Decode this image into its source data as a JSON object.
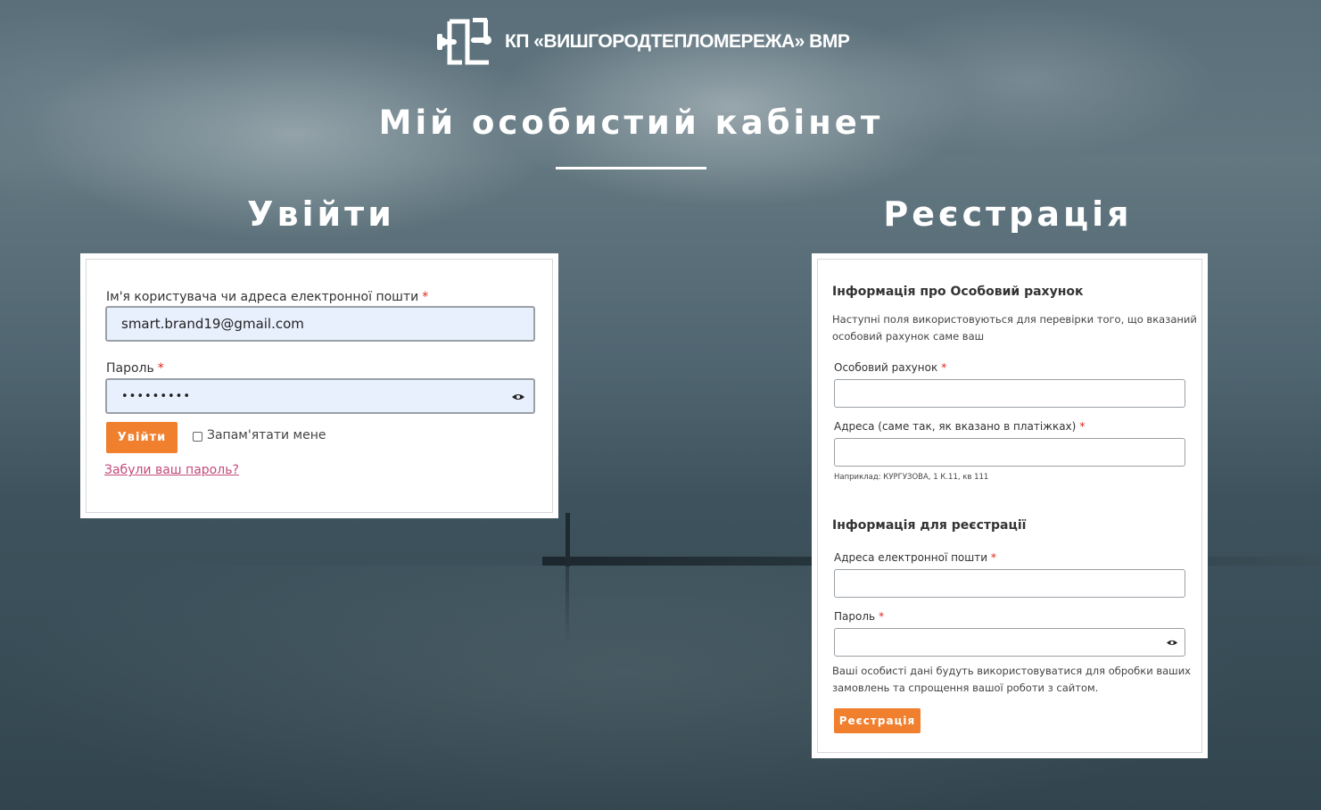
{
  "brand": {
    "name": "КП «ВИШГОРОДТЕПЛОМЕРЕЖА» ВМР",
    "accent_color": "#f07f2e",
    "logo_icon": "pipe-logo-icon"
  },
  "page": {
    "title": "Мій особистий кабінет"
  },
  "login": {
    "heading": "Увійти",
    "username_label": "Ім'я користувача чи адреса електронної пошти",
    "username_value": "smart.brand19@gmail.com",
    "password_label": "Пароль",
    "password_value": "•••••••••",
    "submit_label": "Увійти",
    "remember_label": "Запам'ятати мене",
    "remember_checked": false,
    "forgot_link": "Забули ваш пароль?",
    "required_mark": "*"
  },
  "register": {
    "heading": "Реєстрація",
    "account_section_title": "Інформація про Особовий рахунок",
    "account_section_note_line1": "Наступні поля використовуються для перевірки того, що вказаний",
    "account_section_note_line2": "особовий рахунок саме ваш",
    "account_label": "Особовий рахунок",
    "account_value": "",
    "address_label": "Адреса (саме так, як вказано в платіжках)",
    "address_value": "",
    "address_hint": "Наприклад: КУРГУЗОВА, 1 К.11, кв 111",
    "reg_section_title": "Інформація для реєстрації",
    "email_label": "Адреса електронної пошти",
    "email_value": "",
    "password_label": "Пароль",
    "password_value": "",
    "privacy_line1": "Ваші особисті дані будуть використовуватися для обробки ваших",
    "privacy_line2": "замовлень та спрощення вашої роботи з сайтом.",
    "submit_label": "Реєстрація",
    "required_mark": "*"
  }
}
